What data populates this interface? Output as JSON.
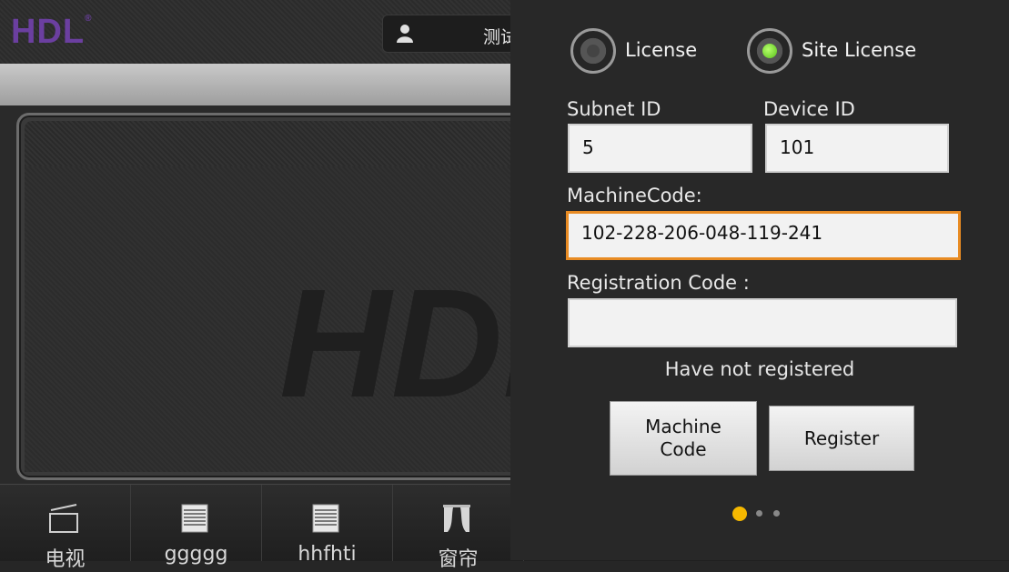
{
  "background_app": {
    "logo": "HDL",
    "logo_mark": "®",
    "user_name": "测试",
    "watermark": "HDL",
    "dock": [
      {
        "label": "电视",
        "icon": "tv-icon"
      },
      {
        "label": "ggggg",
        "icon": "blinds-icon"
      },
      {
        "label": "hhfhti",
        "icon": "blinds-icon"
      },
      {
        "label": "窗帘",
        "icon": "curtain-icon"
      }
    ]
  },
  "dialog": {
    "radio_license": {
      "label": "License",
      "selected": false
    },
    "radio_site_license": {
      "label": "Site License",
      "selected": true
    },
    "subnet_id": {
      "label": "Subnet ID",
      "value": "5"
    },
    "device_id": {
      "label": "Device ID",
      "value": "101"
    },
    "machine_code": {
      "label": "MachineCode:",
      "value": "102-228-206-048-119-241"
    },
    "registration_code": {
      "label": "Registration Code :",
      "value": ""
    },
    "status": "Have not registered",
    "machine_code_button": "Machine Code",
    "register_button": "Register",
    "pager": {
      "count": 3,
      "active": 1
    }
  },
  "colors": {
    "accent_orange": "#e88b23",
    "pager_active": "#f5b800",
    "radio_on": "#58c01a",
    "logo_purple": "#6b3fa0"
  }
}
